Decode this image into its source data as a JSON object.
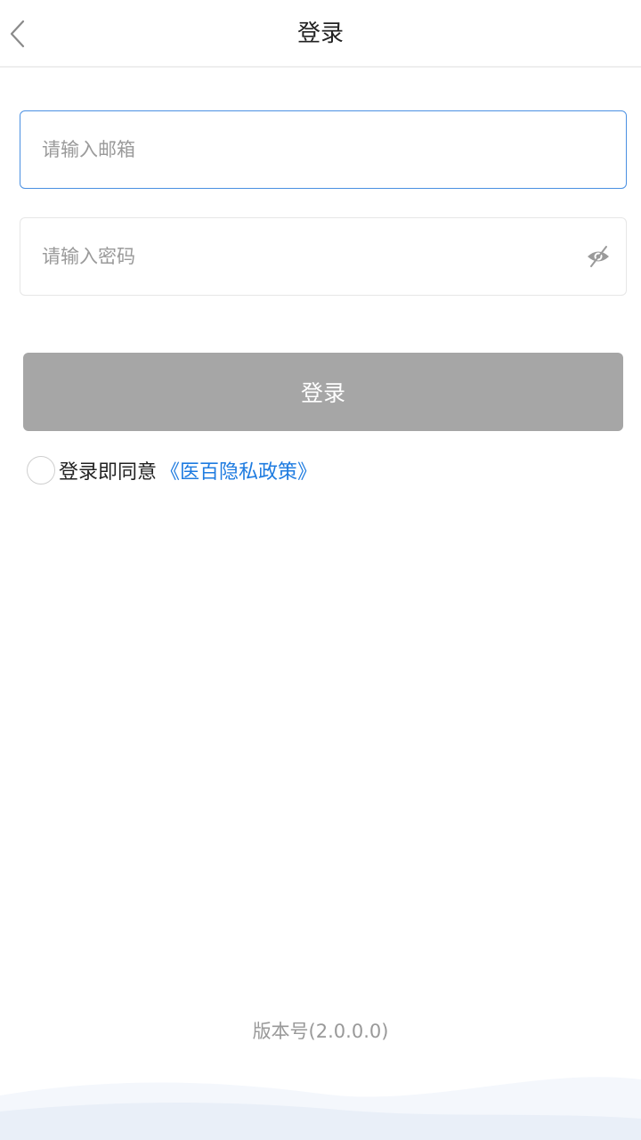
{
  "header": {
    "title": "登录",
    "back_icon": "chevron-left-icon"
  },
  "form": {
    "email_placeholder": "请输入邮箱",
    "email_value": "",
    "password_placeholder": "请输入密码",
    "password_value": "",
    "password_toggle_icon": "eye-off-icon",
    "login_label": "登录"
  },
  "agreement": {
    "checked": false,
    "text": "登录即同意",
    "policy_link": "《医百隐私政策》"
  },
  "footer": {
    "version": "版本号(2.0.0.0)"
  },
  "colors": {
    "accent": "#1e7be0",
    "focus_border": "#4a90e2",
    "button_disabled": "#a6a6a6",
    "wave": "#eef3fa"
  }
}
